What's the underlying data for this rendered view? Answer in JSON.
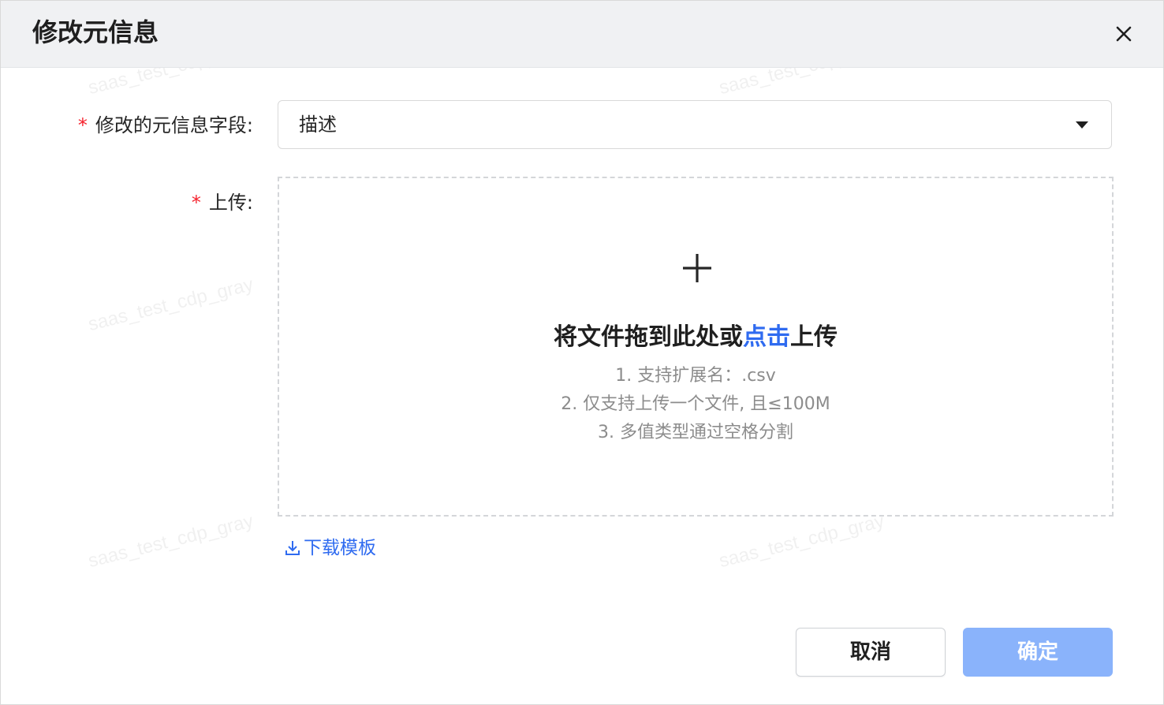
{
  "dialog": {
    "title": "修改元信息",
    "close_icon": "close-icon"
  },
  "form": {
    "field_label": "修改的元信息字段:",
    "field_required": "*",
    "field_value": "描述",
    "upload_label": "上传:",
    "upload_required": "*"
  },
  "upload": {
    "icon": "plus-icon",
    "text_before": "将文件拖到此处或",
    "link_text": "点击",
    "text_after": "上传",
    "hints": [
      "1. 支持扩展名：.csv",
      "2. 仅支持上传一个文件, 且≤100M",
      "3. 多值类型通过空格分割"
    ]
  },
  "download_template": {
    "icon": "download-icon",
    "label": "下载模板"
  },
  "footer": {
    "cancel_label": "取消",
    "confirm_label": "确定"
  },
  "watermark": {
    "text": "saas_test_cdp_gray"
  },
  "colors": {
    "link": "#2f6bf0",
    "required": "#f5222d",
    "confirm_disabled": "#8ab3fb",
    "header_bg": "#f0f1f3"
  }
}
